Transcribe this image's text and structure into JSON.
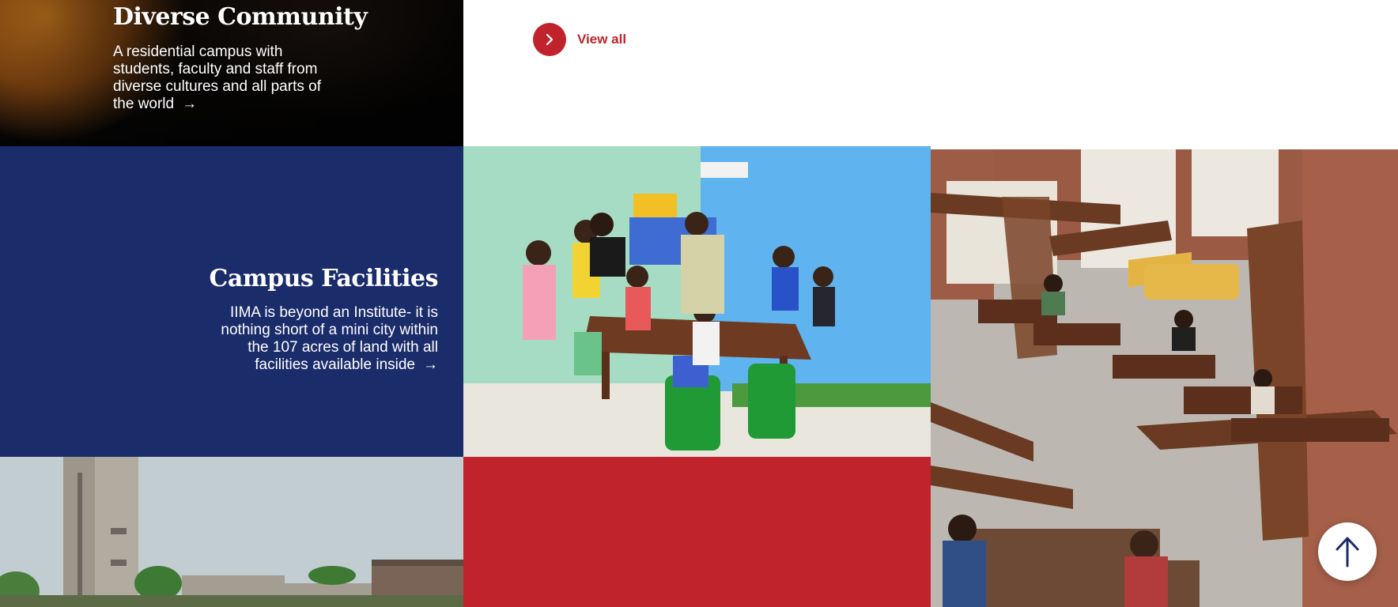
{
  "community": {
    "title": "Diverse Community",
    "text": "A residential campus with students, faculty and staff from diverse cultures and all parts of the world",
    "arrow": "→"
  },
  "view_all": {
    "label": "View all",
    "icon": "chevron-right-icon"
  },
  "facilities": {
    "title": "Campus Facilities",
    "text": "IIMA is beyond an Institute- it is nothing short of a mini city within the 107 acres of land with all facilities available inside",
    "arrow": "→"
  },
  "scroll_top": {
    "icon": "arrow-up-icon"
  },
  "colors": {
    "accent_red": "#c0232c",
    "navy": "#1b2c6b",
    "white": "#ffffff"
  }
}
